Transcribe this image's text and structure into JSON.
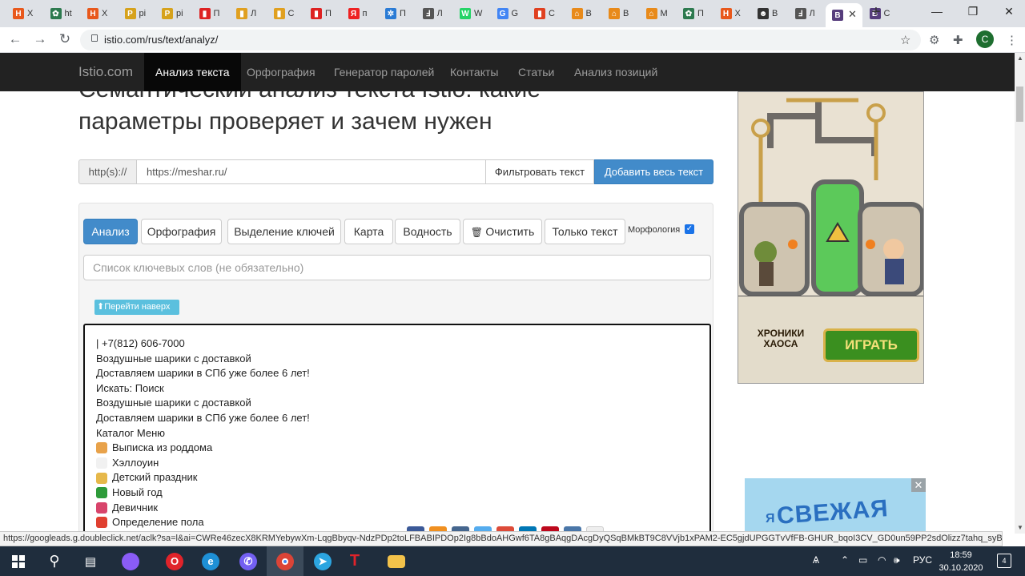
{
  "browser": {
    "tabs": [
      {
        "letter": "H",
        "color": "#e8581c",
        "title": "Х"
      },
      {
        "letter": "✿",
        "color": "#2d7a4f",
        "title": "ht"
      },
      {
        "letter": "H",
        "color": "#e8581c",
        "title": "Х"
      },
      {
        "letter": "P",
        "color": "#d6a21c",
        "title": "pi"
      },
      {
        "letter": "P",
        "color": "#d6a21c",
        "title": "pi"
      },
      {
        "letter": "▮",
        "color": "#d22",
        "title": "П"
      },
      {
        "letter": "▮",
        "color": "#e0a020",
        "title": "Л"
      },
      {
        "letter": "▮",
        "color": "#e0a020",
        "title": "С"
      },
      {
        "letter": "▮",
        "color": "#d22",
        "title": "П"
      },
      {
        "letter": "Я",
        "color": "#e22",
        "title": "п"
      },
      {
        "letter": "✲",
        "color": "#2a7bd5",
        "title": "П"
      },
      {
        "letter": "Ⅎ",
        "color": "#555",
        "title": "Л"
      },
      {
        "letter": "W",
        "color": "#25d366",
        "title": "W"
      },
      {
        "letter": "G",
        "color": "#4285f4",
        "title": "G"
      },
      {
        "letter": "▮",
        "color": "#e04020",
        "title": "С"
      },
      {
        "letter": "⌂",
        "color": "#e88a1a",
        "title": "В"
      },
      {
        "letter": "⌂",
        "color": "#e88a1a",
        "title": "В"
      },
      {
        "letter": "⌂",
        "color": "#e88a1a",
        "title": "М"
      },
      {
        "letter": "✿",
        "color": "#2d7a4f",
        "title": "П"
      },
      {
        "letter": "H",
        "color": "#e8581c",
        "title": "Х"
      },
      {
        "letter": "☻",
        "color": "#333",
        "title": "В"
      },
      {
        "letter": "Ⅎ",
        "color": "#555",
        "title": "Л"
      },
      {
        "letter": "B",
        "color": "#563d7c",
        "title": ""
      },
      {
        "letter": "B",
        "color": "#563d7c",
        "title": "С"
      }
    ],
    "url": "istio.com/rus/text/analyz/",
    "profile_letter": "C",
    "status_url": "https://googleads.g.doubleclick.net/aclk?sa=l&ai=CWRe46zecX8KRMYebywXm-LqgBbyqv-NdzPDp2toLFBABIPDOp2Ig8bBdoAHGwf6TA8gBAqgDAcgDyQSqBMkBT9C8VVjb1xPAM2-EC5gjdUPGGTvVfFB-GHUR_bqoI3CV_GD0un59PP2sdOlizz7tahq_syB..."
  },
  "site": {
    "brand": "Istio.com",
    "nav": [
      {
        "label": "Анализ текста",
        "active": true
      },
      {
        "label": "Орфография",
        "active": false
      },
      {
        "label": "Генератор паролей",
        "active": false
      },
      {
        "label": "Контакты",
        "active": false
      },
      {
        "label": "Статьи",
        "active": false
      },
      {
        "label": "Анализ позиций",
        "active": false
      }
    ],
    "heading_line1": "Семантический анализ текста Istio: какие",
    "heading_line2": "параметры проверяет и зачем нужен",
    "url_addon": "http(s)://",
    "url_value": "https://meshar.ru/",
    "filter_button": "Фильтровать текст",
    "add_all_button": "Добавить весь текст",
    "tool_buttons": [
      {
        "label": "Анализ",
        "primary": true
      },
      {
        "label": "Орфография",
        "primary": false
      },
      {
        "label": "Выделение ключей",
        "primary": false
      },
      {
        "label": "Карта",
        "primary": false
      },
      {
        "label": "Водность",
        "primary": false
      },
      {
        "label": "Очистить",
        "primary": false,
        "icon": "trash-icon"
      },
      {
        "label": "Только текст",
        "primary": false
      }
    ],
    "morphology_label": "Морфология",
    "morphology_checked": true,
    "keywords_placeholder": "Список ключевых слов (не обязательно)",
    "go_top": "Перейти наверх",
    "text_lines": [
      {
        "text": "| +7(812) 606-7000"
      },
      {
        "text": "Воздушные шарики с доставкой"
      },
      {
        "text": "Доставляем шарики в СПб уже более 6 лет!"
      },
      {
        "text": "Искать: Поиск"
      },
      {
        "text": "Воздушные шарики с доставкой"
      },
      {
        "text": "Доставляем шарики в СПб уже более 6 лет!"
      },
      {
        "text": "Каталог Меню"
      },
      {
        "text": "Выписка из роддома",
        "emoji": "#e8a24a"
      },
      {
        "text": "Хэллоуин",
        "emoji": "#f1f1f1"
      },
      {
        "text": "Детский праздник",
        "emoji": "#e6b84a"
      },
      {
        "text": "Новый год",
        "emoji": "#2e9b3a"
      },
      {
        "text": "Девичник",
        "emoji": "#d8446b"
      },
      {
        "text": "Определение пола",
        "emoji": "#e04030"
      }
    ]
  },
  "ads": {
    "game_logo": "ХРОНИКИ ХАОСА",
    "play_button": "ИГРАТЬ",
    "banner_text": "СВЕЖАЯ",
    "banner_letter": "Я",
    "close": "✕"
  },
  "taskbar": {
    "language": "РУС",
    "time": "18:59",
    "date": "30.10.2020",
    "notifications": "4"
  }
}
